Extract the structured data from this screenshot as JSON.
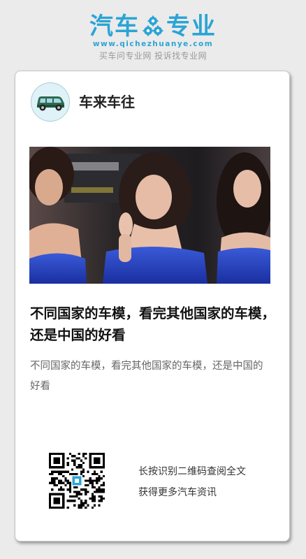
{
  "brand": {
    "logo_left": "汽车",
    "logo_right": "专业",
    "url": "www.qichezhuanye.com",
    "slogan": "买车问专业网 投诉找专业网",
    "color": "#2ba4d6"
  },
  "channel": {
    "name": "车来车往",
    "avatar_icon": "car-icon"
  },
  "article": {
    "title": "不同国家的车模，看完其他国家的车模，还是中国的好看",
    "summary": "不同国家的车模，看完其他国家的车模，还是中国的好看"
  },
  "qr": {
    "line1": "长按识别二维码查阅全文",
    "line2": "获得更多汽车资讯"
  }
}
